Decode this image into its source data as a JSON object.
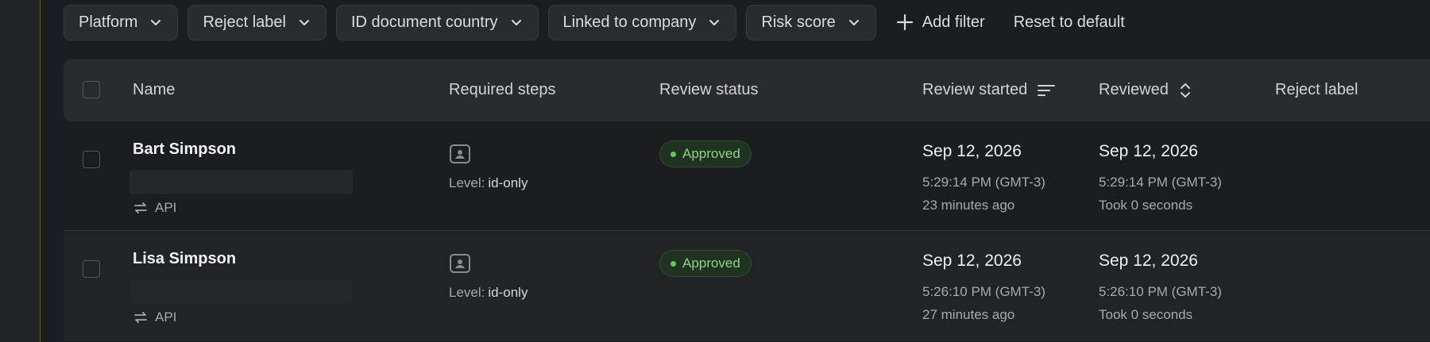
{
  "filters": [
    {
      "label": "Platform"
    },
    {
      "label": "Reject label"
    },
    {
      "label": "ID document country"
    },
    {
      "label": "Linked to company"
    },
    {
      "label": "Risk score"
    }
  ],
  "actions": {
    "add_filter": "Add filter",
    "reset": "Reset to default"
  },
  "table": {
    "columns": {
      "name": "Name",
      "required_steps": "Required steps",
      "review_status": "Review status",
      "review_started": "Review started",
      "reviewed": "Reviewed",
      "reject_label": "Reject label"
    },
    "rows": [
      {
        "name": "Bart Simpson",
        "source": "API",
        "level_label": "Level:",
        "level": "id-only",
        "status": "Approved",
        "started_date": "Sep 12, 2026",
        "started_time": "5:29:14 PM (GMT-3)",
        "started_rel": "23 minutes ago",
        "reviewed_date": "Sep 12, 2026",
        "reviewed_time": "5:29:14 PM (GMT-3)",
        "reviewed_took": "Took 0 seconds"
      },
      {
        "name": "Lisa Simpson",
        "source": "API",
        "level_label": "Level:",
        "level": "id-only",
        "status": "Approved",
        "started_date": "Sep 12, 2026",
        "started_time": "5:26:10 PM (GMT-3)",
        "started_rel": "27 minutes ago",
        "reviewed_date": "Sep 12, 2026",
        "reviewed_time": "5:26:10 PM (GMT-3)",
        "reviewed_took": "Took 0 seconds"
      }
    ]
  },
  "icons": {
    "chip": "chevron-down-icon",
    "add": "plus-icon",
    "sort_active": "sort-lines-icon",
    "sort_idle": "sort-updown-icon",
    "source": "transfer-arrows-icon",
    "step": "id-card-icon"
  },
  "colors": {
    "approved_text": "#8fd18a",
    "approved_bg": "#1f3320"
  }
}
